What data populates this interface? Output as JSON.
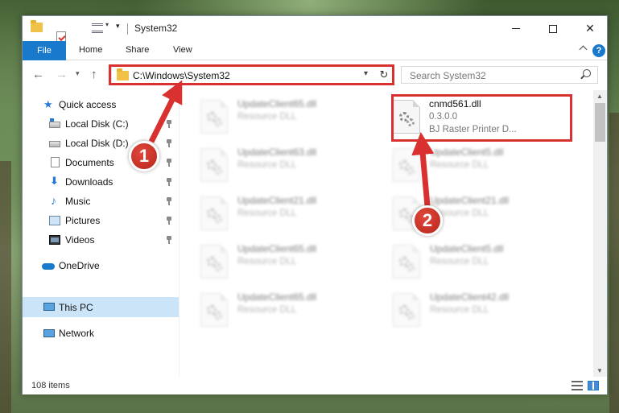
{
  "titlebar": {
    "title": "System32",
    "minimize": "minimize",
    "maximize": "maximize",
    "close": "✕"
  },
  "ribbon": {
    "tabs": [
      "File",
      "Home",
      "Share",
      "View"
    ],
    "help": "?"
  },
  "address": {
    "path": "C:\\Windows\\System32",
    "search_placeholder": "Search System32"
  },
  "sidebar": {
    "items": [
      {
        "label": "Quick access",
        "icon": "star-icon"
      },
      {
        "label": "Local Disk (C:)",
        "icon": "disk-icon",
        "pinned": true
      },
      {
        "label": "Local Disk (D:)",
        "icon": "disk-icon",
        "pinned": true
      },
      {
        "label": "Documents",
        "icon": "document-icon",
        "pinned": true
      },
      {
        "label": "Downloads",
        "icon": "download-icon",
        "pinned": true
      },
      {
        "label": "Music",
        "icon": "music-icon",
        "pinned": true
      },
      {
        "label": "Pictures",
        "icon": "pictures-icon",
        "pinned": true
      },
      {
        "label": "Videos",
        "icon": "videos-icon",
        "pinned": true
      },
      {
        "label": "OneDrive",
        "icon": "cloud-icon"
      },
      {
        "label": "This PC",
        "icon": "computer-icon",
        "selected": true
      },
      {
        "label": "Network",
        "icon": "network-icon"
      }
    ]
  },
  "files": [
    {
      "name": "UpdateClient65.dll",
      "line2": "Resource DLL",
      "line3": "",
      "blurred": true
    },
    {
      "name": "cnmd561.dll",
      "line2": "0.3.0.0",
      "line3": "BJ Raster Printer D...",
      "blurred": false
    },
    {
      "name": "UpdateClient63.dll",
      "line2": "Resource DLL",
      "line3": "",
      "blurred": true
    },
    {
      "name": "UpdateClient5.dll",
      "line2": "Resource DLL",
      "line3": "",
      "blurred": true
    },
    {
      "name": "UpdateClient21.dll",
      "line2": "Resource DLL",
      "line3": "",
      "blurred": true
    },
    {
      "name": "UpdateClient21.dll",
      "line2": "Resource DLL",
      "line3": "",
      "blurred": true
    },
    {
      "name": "UpdateClient65.dll",
      "line2": "Resource DLL",
      "line3": "",
      "blurred": true
    },
    {
      "name": "UpdateClient5.dll",
      "line2": "Resource DLL",
      "line3": "",
      "blurred": true
    },
    {
      "name": "UpdateClient65.dll",
      "line2": "Resource DLL",
      "line3": "",
      "blurred": true
    },
    {
      "name": "UpdateClient42.dll",
      "line2": "Resource DLL",
      "line3": "",
      "blurred": true
    }
  ],
  "status": {
    "item_count": "108 items"
  },
  "annotations": {
    "badge1": "1",
    "badge2": "2",
    "color": "#d8312f"
  },
  "colors": {
    "accent": "#1979ca",
    "selected": "#cce4f7",
    "highlight": "#d8312f"
  }
}
